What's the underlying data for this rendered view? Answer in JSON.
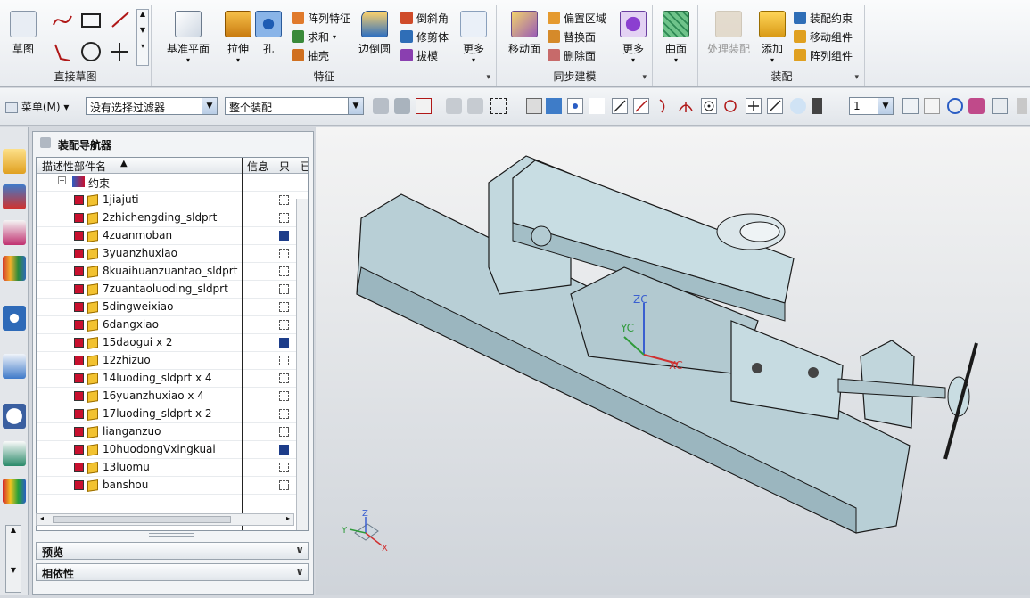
{
  "ribbon": {
    "groups": {
      "sketch": {
        "title": "直接草图",
        "label": "草图"
      },
      "feature": {
        "title": "特征",
        "datum_plane": "基准平面",
        "extrude": "拉伸",
        "hole": "孔",
        "pattern_feature": "阵列特征",
        "unite": "求和",
        "shell": "抽壳",
        "edge_blend": "边倒圆",
        "chamfer": "倒斜角",
        "trim_body": "修剪体",
        "draft": "拔模",
        "more": "更多"
      },
      "sync": {
        "title": "同步建模",
        "move_face": "移动面",
        "offset_region": "偏置区域",
        "replace_face": "替换面",
        "delete_face": "删除面",
        "more": "更多"
      },
      "surface": {
        "label": "曲面"
      },
      "assembly": {
        "title": "装配",
        "process_assembly": "处理装配",
        "add": "添加",
        "assembly_constraint": "装配约束",
        "move_component": "移动组件",
        "pattern_component": "阵列组件"
      }
    }
  },
  "toolbar2": {
    "menu": "菜单(M)",
    "filter": "没有选择过滤器",
    "scope": "整个装配",
    "layer": "1"
  },
  "navigator": {
    "title": "装配导航器",
    "col_name": "描述性部件名",
    "col_info": "信息",
    "col_readonly": "只",
    "col_more": "已",
    "constraints": "约束",
    "rows": [
      {
        "name": "1jiajuti",
        "saved": false
      },
      {
        "name": "2zhichengding_sldprt",
        "saved": false
      },
      {
        "name": "4zuanmoban",
        "saved": true
      },
      {
        "name": "3yuanzhuxiao",
        "saved": false
      },
      {
        "name": "8kuaihuanzuantao_sldprt",
        "saved": false
      },
      {
        "name": "7zuantaoluoding_sldprt",
        "saved": false
      },
      {
        "name": "5dingweixiao",
        "saved": false
      },
      {
        "name": "6dangxiao",
        "saved": false
      },
      {
        "name": "15daogui x 2",
        "saved": true
      },
      {
        "name": "12zhizuo",
        "saved": false
      },
      {
        "name": "14luoding_sldprt x 4",
        "saved": false
      },
      {
        "name": "16yuanzhuxiao x 4",
        "saved": false
      },
      {
        "name": "17luoding_sldprt x 2",
        "saved": false
      },
      {
        "name": "lianganzuo",
        "saved": false
      },
      {
        "name": "10huodongVxingkuai",
        "saved": true
      },
      {
        "name": "13luomu",
        "saved": false
      },
      {
        "name": "banshou",
        "saved": false
      }
    ],
    "preview": "预览",
    "dependency": "相依性"
  },
  "viewport": {
    "axes": {
      "xc": "XC",
      "yc": "YC",
      "zc": "ZC"
    },
    "triad": {
      "x": "X",
      "y": "Y",
      "z": "Z"
    }
  }
}
